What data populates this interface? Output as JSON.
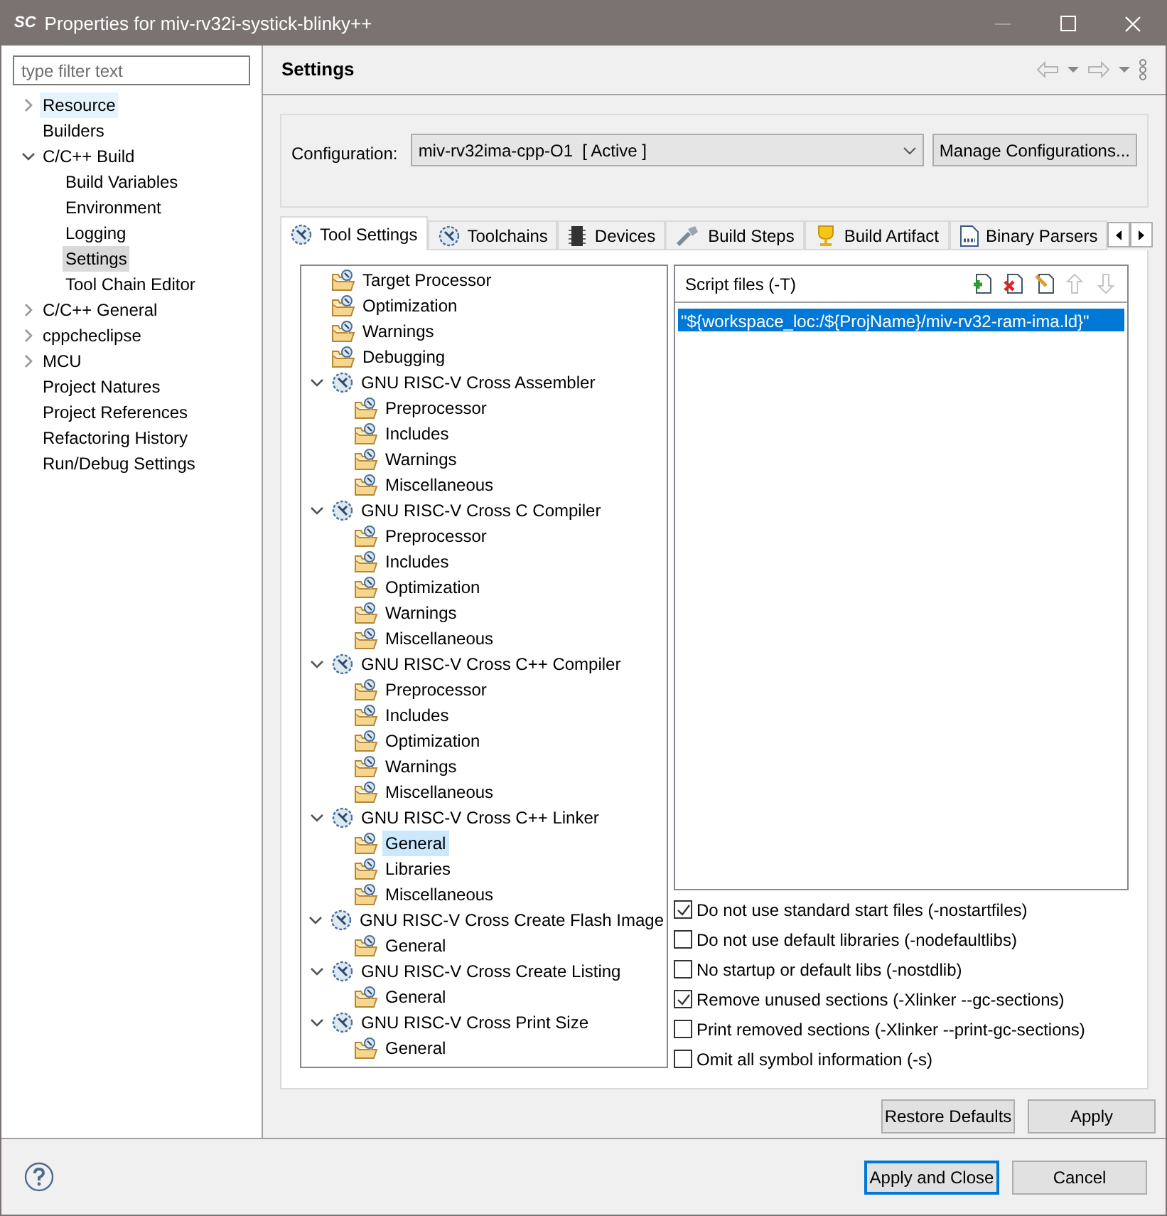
{
  "window": {
    "title": "Properties for miv-rv32i-systick-blinky++",
    "logo": "SC"
  },
  "sidebar": {
    "filter_placeholder": "type filter text",
    "items": [
      {
        "label": "Resource",
        "kind": "group",
        "expanded": false,
        "selected": false,
        "hovered": true
      },
      {
        "label": "Builders",
        "kind": "page",
        "selected": false,
        "hovered": false
      },
      {
        "label": "C/C++ Build",
        "kind": "group",
        "expanded": true,
        "selected": false,
        "hovered": false,
        "children": [
          {
            "label": "Build Variables",
            "kind": "page",
            "selected": false,
            "hovered": false
          },
          {
            "label": "Environment",
            "kind": "page",
            "selected": false,
            "hovered": false
          },
          {
            "label": "Logging",
            "kind": "page",
            "selected": false,
            "hovered": false
          },
          {
            "label": "Settings",
            "kind": "page",
            "selected": true,
            "hovered": false
          },
          {
            "label": "Tool Chain Editor",
            "kind": "page",
            "selected": false,
            "hovered": false
          }
        ]
      },
      {
        "label": "C/C++ General",
        "kind": "group",
        "expanded": false,
        "selected": false,
        "hovered": false
      },
      {
        "label": "cppcheclipse",
        "kind": "group",
        "expanded": false,
        "selected": false,
        "hovered": false
      },
      {
        "label": "MCU",
        "kind": "group",
        "expanded": false,
        "selected": false,
        "hovered": false
      },
      {
        "label": "Project Natures",
        "kind": "page",
        "selected": false,
        "hovered": false
      },
      {
        "label": "Project References",
        "kind": "page",
        "selected": false,
        "hovered": false
      },
      {
        "label": "Refactoring History",
        "kind": "page",
        "selected": false,
        "hovered": false
      },
      {
        "label": "Run/Debug Settings",
        "kind": "page",
        "selected": false,
        "hovered": false
      }
    ]
  },
  "page": {
    "title": "Settings",
    "configuration": {
      "label": "Configuration:",
      "value": "miv-rv32ima-cpp-O1  [ Active ]",
      "manage_button": "Manage Configurations..."
    },
    "tabs": [
      {
        "label": "Tool Settings",
        "selected": true
      },
      {
        "label": "Toolchains",
        "selected": false
      },
      {
        "label": "Devices",
        "selected": false
      },
      {
        "label": "Build Steps",
        "selected": false
      },
      {
        "label": "Build Artifact",
        "selected": false
      },
      {
        "label": "Binary Parsers",
        "selected": false
      }
    ],
    "tool_tree": [
      {
        "label": "Target Processor",
        "kind": "option",
        "selected": false
      },
      {
        "label": "Optimization",
        "kind": "option",
        "selected": false
      },
      {
        "label": "Warnings",
        "kind": "option",
        "selected": false
      },
      {
        "label": "Debugging",
        "kind": "option",
        "selected": false
      },
      {
        "label": "GNU RISC-V Cross Assembler",
        "kind": "tool",
        "expanded": true,
        "selected": false,
        "children": [
          {
            "label": "Preprocessor",
            "kind": "option",
            "selected": false
          },
          {
            "label": "Includes",
            "kind": "option",
            "selected": false
          },
          {
            "label": "Warnings",
            "kind": "option",
            "selected": false
          },
          {
            "label": "Miscellaneous",
            "kind": "option",
            "selected": false
          }
        ]
      },
      {
        "label": "GNU RISC-V Cross C Compiler",
        "kind": "tool",
        "expanded": true,
        "selected": false,
        "children": [
          {
            "label": "Preprocessor",
            "kind": "option",
            "selected": false
          },
          {
            "label": "Includes",
            "kind": "option",
            "selected": false
          },
          {
            "label": "Optimization",
            "kind": "option",
            "selected": false
          },
          {
            "label": "Warnings",
            "kind": "option",
            "selected": false
          },
          {
            "label": "Miscellaneous",
            "kind": "option",
            "selected": false
          }
        ]
      },
      {
        "label": "GNU RISC-V Cross C++ Compiler",
        "kind": "tool",
        "expanded": true,
        "selected": false,
        "children": [
          {
            "label": "Preprocessor",
            "kind": "option",
            "selected": false
          },
          {
            "label": "Includes",
            "kind": "option",
            "selected": false
          },
          {
            "label": "Optimization",
            "kind": "option",
            "selected": false
          },
          {
            "label": "Warnings",
            "kind": "option",
            "selected": false
          },
          {
            "label": "Miscellaneous",
            "kind": "option",
            "selected": false
          }
        ]
      },
      {
        "label": "GNU RISC-V Cross C++ Linker",
        "kind": "tool",
        "expanded": true,
        "selected": false,
        "children": [
          {
            "label": "General",
            "kind": "option",
            "selected": true
          },
          {
            "label": "Libraries",
            "kind": "option",
            "selected": false
          },
          {
            "label": "Miscellaneous",
            "kind": "option",
            "selected": false
          }
        ]
      },
      {
        "label": "GNU RISC-V Cross Create Flash Image",
        "kind": "tool",
        "expanded": true,
        "selected": false,
        "children": [
          {
            "label": "General",
            "kind": "option",
            "selected": false
          }
        ]
      },
      {
        "label": "GNU RISC-V Cross Create Listing",
        "kind": "tool",
        "expanded": true,
        "selected": false,
        "children": [
          {
            "label": "General",
            "kind": "option",
            "selected": false
          }
        ]
      },
      {
        "label": "GNU RISC-V Cross Print Size",
        "kind": "tool",
        "expanded": true,
        "selected": false,
        "children": [
          {
            "label": "General",
            "kind": "option",
            "selected": false
          }
        ]
      }
    ],
    "script_files": {
      "title": "Script files (-T)",
      "items": [
        {
          "text": "\"${workspace_loc:/${ProjName}/miv-rv32-ram-ima.ld}\"",
          "selected": true
        }
      ]
    },
    "options": [
      {
        "label": "Do not use standard start files (-nostartfiles)",
        "checked": true
      },
      {
        "label": "Do not use default libraries (-nodefaultlibs)",
        "checked": false
      },
      {
        "label": "No startup or default libs (-nostdlib)",
        "checked": false
      },
      {
        "label": "Remove unused sections (-Xlinker --gc-sections)",
        "checked": true
      },
      {
        "label": "Print removed sections (-Xlinker --print-gc-sections)",
        "checked": false
      },
      {
        "label": "Omit all symbol information (-s)",
        "checked": false
      }
    ],
    "restore_button": "Restore Defaults",
    "apply_button": "Apply"
  },
  "footer": {
    "apply_close_button": "Apply and Close",
    "cancel_button": "Cancel"
  }
}
